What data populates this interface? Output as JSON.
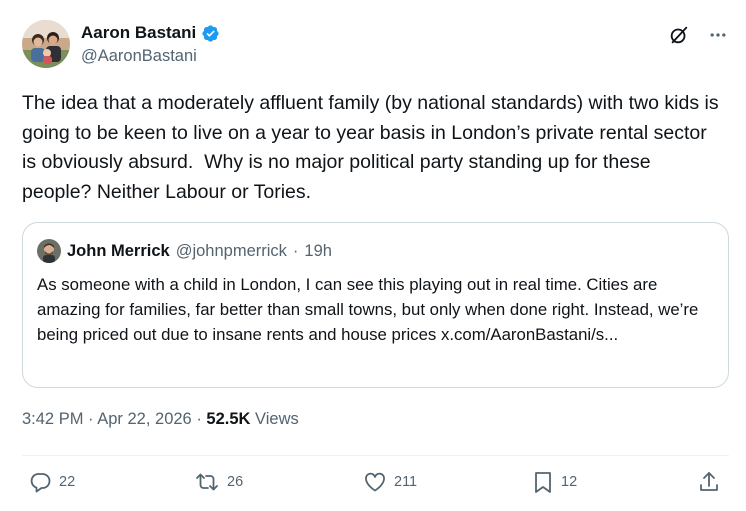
{
  "author": {
    "name": "Aaron Bastani",
    "handle": "@AaronBastani"
  },
  "icons": {
    "verified": "verified-badge-icon",
    "grok": "grok-icon",
    "more": "more-horizontal-icon",
    "reply": "reply-icon",
    "repost": "repost-icon",
    "like": "like-icon",
    "bookmark": "bookmark-icon",
    "share": "share-icon"
  },
  "colors": {
    "accent": "#1d9bf0",
    "text": "#0f1419",
    "muted": "#536471",
    "border": "#cfd9de"
  },
  "post": {
    "text": "The idea that a moderately affluent family (by national standards) with two kids is going to be keen to live on a year to year basis in London’s private rental sector is obviously absurd.  Why is no major political party standing up for these people? Neither Labour or Tories."
  },
  "quote": {
    "name": "John Merrick",
    "handle": "@johnpmerrick",
    "separator": "·",
    "time": "19h",
    "text": "As someone with a child in London, I can see this playing out in real time. Cities are amazing for families, far better than small towns, but only when done right. Instead, we’re being priced out due to insane rents and house prices x.com/AaronBastani/s..."
  },
  "meta": {
    "time": "3:42 PM",
    "sep1": "·",
    "date": "Apr 22, 2026",
    "sep2": "·",
    "views_count": "52.5K",
    "views_label": "Views"
  },
  "actions": {
    "replies": "22",
    "reposts": "26",
    "likes": "211",
    "bookmarks": "12"
  }
}
